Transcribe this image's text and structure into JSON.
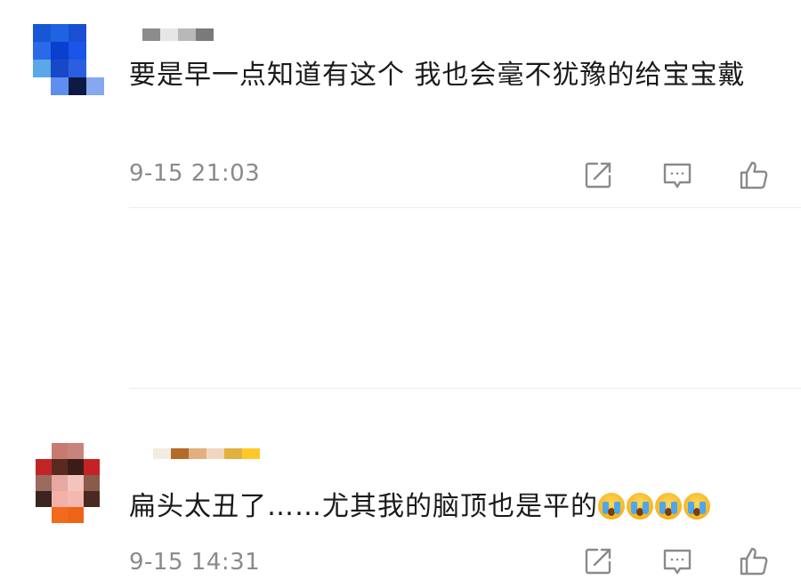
{
  "comments": [
    {
      "text": "要是早一点知道有这个 我也会毫不犹豫的给宝宝戴",
      "timestamp": "9-15 21:03",
      "avatar_colors": [
        "#1757d6",
        "#1f63e0",
        "#1b4fd1",
        "#ffffff",
        "#2a6ae8",
        "#0a3fd0",
        "#1b54e8",
        "#ffffff",
        "#5aa8e8",
        "#1748c8",
        "#2c5fe0",
        "#ffffff",
        "#ffffff",
        "#5e8ff0",
        "#0c1a44",
        "#86a8ee"
      ],
      "name_colors": [
        "#8c8c8c",
        "#e6e6e6",
        "#b8b8b8",
        "#7a7a7a"
      ]
    },
    {
      "text": "扁头太丑了……尤其我的脑顶也是平的",
      "emoji_count": 4,
      "emoji_name": "crying-face",
      "timestamp": "9-15 14:31",
      "avatar_colors": [
        "#ffffff",
        "#c77a70",
        "#c8847c",
        "#ffffff",
        "#c32525",
        "#5a2a20",
        "#3b1d18",
        "#c52323",
        "#9a6b5e",
        "#e6a8a0",
        "#f2c4bc",
        "#8a5a4a",
        "#3a2420",
        "#f2b0a8",
        "#f4b8b0",
        "#4a2a20",
        "#ffffff",
        "#f26a1c",
        "#ee6418",
        "#ffffff"
      ],
      "name_colors": [
        "#f3ece0",
        "#b46a28",
        "#e2b07c",
        "#f0d8c0",
        "#e0b040",
        "#ffc828"
      ]
    }
  ],
  "actions": {
    "share_icon": "share-icon",
    "reply_icon": "reply-icon",
    "like_icon": "thumbs-up-icon",
    "icon_color": "#8a8a8a"
  }
}
